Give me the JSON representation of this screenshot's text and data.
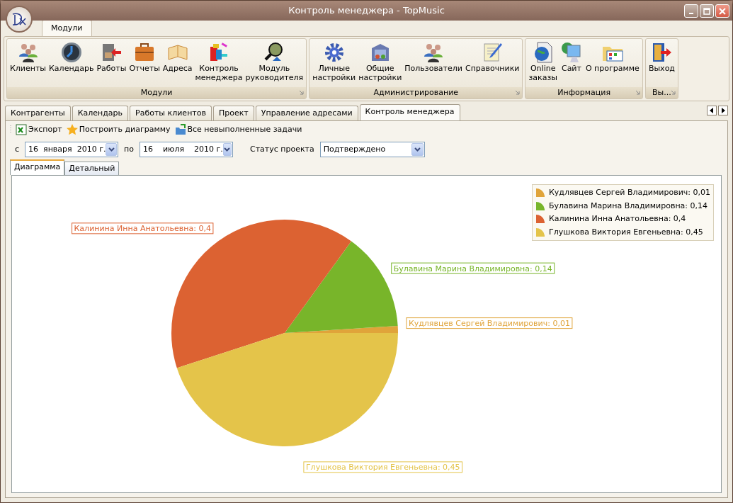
{
  "window": {
    "title": "Контроль менеджера - TopMusic"
  },
  "ribbon_tabs": [
    {
      "label": "Модули",
      "selected": true
    }
  ],
  "ribbon_groups": [
    {
      "title": "Модули",
      "buttons": [
        "Клиенты",
        "Календарь",
        "Работы",
        "Отчеты",
        "Адреса",
        "Контроль\nменеджера",
        "Модуль\nруководителя"
      ]
    },
    {
      "title": "Администрирование",
      "buttons": [
        "Личные\nнастройки",
        "Общие\nнастройки",
        "Пользователи",
        "Справочники"
      ]
    },
    {
      "title": "Информация",
      "buttons": [
        "Online\nзаказы",
        "Сайт",
        "О программе"
      ]
    },
    {
      "title": "Вы...",
      "buttons": [
        "Выход"
      ]
    }
  ],
  "document_tabs": [
    {
      "label": "Контрагенты",
      "selected": false
    },
    {
      "label": "Календарь",
      "selected": false
    },
    {
      "label": "Работы клиентов",
      "selected": false
    },
    {
      "label": "Проект",
      "selected": false
    },
    {
      "label": "Управление адресами",
      "selected": false
    },
    {
      "label": "Контроль менеджера",
      "selected": true
    }
  ],
  "toolbar": [
    "Экспорт",
    "Построить диаграмму",
    "Все невыполненные задачи"
  ],
  "filter": {
    "from_label": "с",
    "from": "16  января  2010 г.",
    "to_label": "по",
    "to": "16    июля    2010 г.",
    "status_label": "Статус проекта",
    "status": "Подтверждено"
  },
  "view_tabs": [
    {
      "label": "Диаграмма",
      "selected": true
    },
    {
      "label": "Детальный",
      "selected": false
    }
  ],
  "chart_data": {
    "type": "pie",
    "series": [
      {
        "values": [
          0.01,
          0.14,
          0.4,
          0.45
        ]
      }
    ],
    "colors": [
      "#e0a43a",
      "#78b52a",
      "#dc6232",
      "#e4c44a"
    ],
    "annotations": [
      {
        "text": "Кудлявцев Сергей Владимирович: 0,01"
      },
      {
        "text": "Булавина Марина Владимировна: 0,14"
      },
      {
        "text": "Калинина Инна Анатольевна: 0,4"
      },
      {
        "text": "Глушкова Виктория Евгеньевна: 0,45"
      }
    ]
  },
  "legend": [
    "Кудлявцев Сергей Владимирович: 0,01",
    "Булавина Марина Владимировна: 0,14",
    "Калинина Инна Анатольевна: 0,4",
    "Глушкова Виктория Евгеньевна: 0,45"
  ]
}
